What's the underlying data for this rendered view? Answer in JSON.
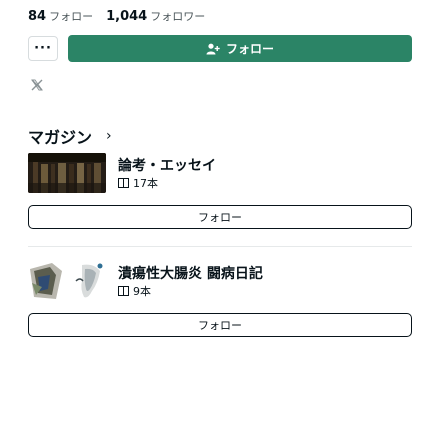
{
  "stats": {
    "following_count": "84",
    "following_label": "フォロー",
    "followers_count": "1,044",
    "followers_label": "フォロワー"
  },
  "actions": {
    "more_label": "···",
    "follow_label": "フォロー"
  },
  "social": {
    "icon": "x-icon"
  },
  "magazines": {
    "heading": "マガジン",
    "chevron": "›",
    "items": [
      {
        "title": "論考・エッセイ",
        "count": "17本",
        "follow_label": "フォロー"
      },
      {
        "title": "潰瘍性大腸炎 闘病日記",
        "count": "9本",
        "follow_label": "フォロー"
      }
    ]
  },
  "colors": {
    "accent": "#2b8466",
    "text": "#08131a",
    "border": "#d7dcde"
  }
}
